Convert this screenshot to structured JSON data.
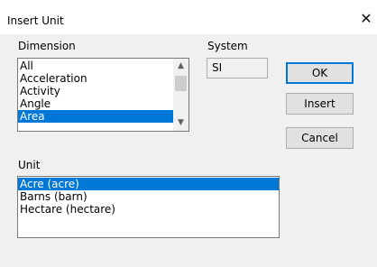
{
  "window": {
    "title": "Insert Unit",
    "close_glyph": "✕"
  },
  "dimension": {
    "label": "Dimension",
    "items": [
      "All",
      "Acceleration",
      "Activity",
      "Angle",
      "Area"
    ],
    "selected": "Area"
  },
  "system": {
    "label": "System",
    "value": "SI"
  },
  "buttons": {
    "ok": "OK",
    "insert": "Insert",
    "cancel": "Cancel"
  },
  "unit": {
    "label": "Unit",
    "items": [
      "Acre (acre)",
      "Barns (barn)",
      "Hectare (hectare)"
    ],
    "selected": "Acre (acre)"
  },
  "colors": {
    "accent": "#0078d7",
    "dialog_bg": "#f0f0f0"
  }
}
